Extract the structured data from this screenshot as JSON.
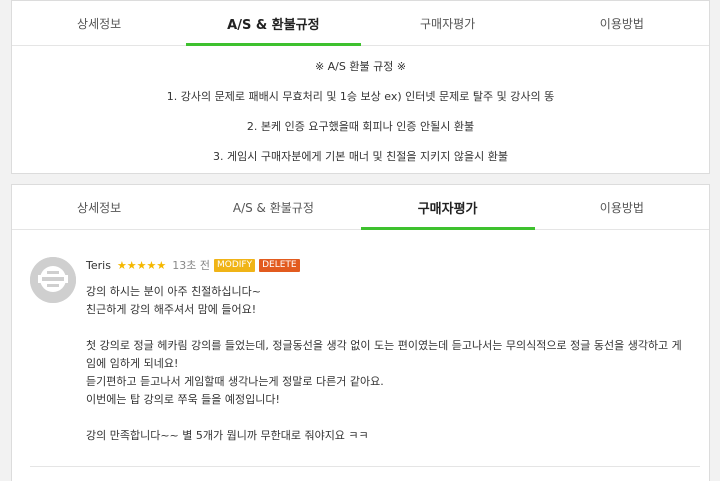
{
  "tabs_top": [
    {
      "label": "상세정보",
      "active": false
    },
    {
      "label": "A/S & 환불규정",
      "active": true
    },
    {
      "label": "구매자평가",
      "active": false
    },
    {
      "label": "이용방법",
      "active": false
    }
  ],
  "policy": {
    "title": "※ A/S 환불 규정 ※",
    "lines": [
      "1. 강사의 문제로 패배시 무효처리 및 1승 보상 ex) 인터넷 문제로 탈주 및 강사의 똥",
      "2. 본케 인증 요구했을때 회피나 인증 안될시 환불",
      "3. 게임시 구매자분에게 기본 매너 및 친절을 지키지 않을시 환불"
    ]
  },
  "tabs_bottom": [
    {
      "label": "상세정보",
      "active": false
    },
    {
      "label": "A/S & 환불규정",
      "active": false
    },
    {
      "label": "구매자평가",
      "active": true
    },
    {
      "label": "이용방법",
      "active": false
    }
  ],
  "review": {
    "author": "Teris",
    "rating": 5,
    "stars": "★★★★★",
    "time_ago": "13초 전",
    "modify_label": "MODIFY",
    "delete_label": "DELETE",
    "lines": [
      "강의 하시는 분이 아주 친절하십니다~",
      "친근하게 강의 해주셔서 맘에 들어요!",
      "",
      "첫 강의로 정글 헤카림 강의를 들었는데, 정글동선을 생각 없이 도는 편이였는데 듣고나서는 무의식적으로 정글 동선을 생각하고 게",
      "임에 임하게 되네요!",
      "듣기편하고 듣고나서 게임할때 생각나는게 정말로 다른거 같아요.",
      "이번에는 탑 강의로 쭈욱 들을 예정입니다!",
      "",
      "강의 만족합니다~~ 별 5개가 뭡니까 무한대로 줘야지요 ㅋㅋ"
    ]
  },
  "colors": {
    "accent": "#3ec12e",
    "star": "#f5b800",
    "modify_badge": "#f0b417",
    "delete_badge": "#e25b1f"
  }
}
